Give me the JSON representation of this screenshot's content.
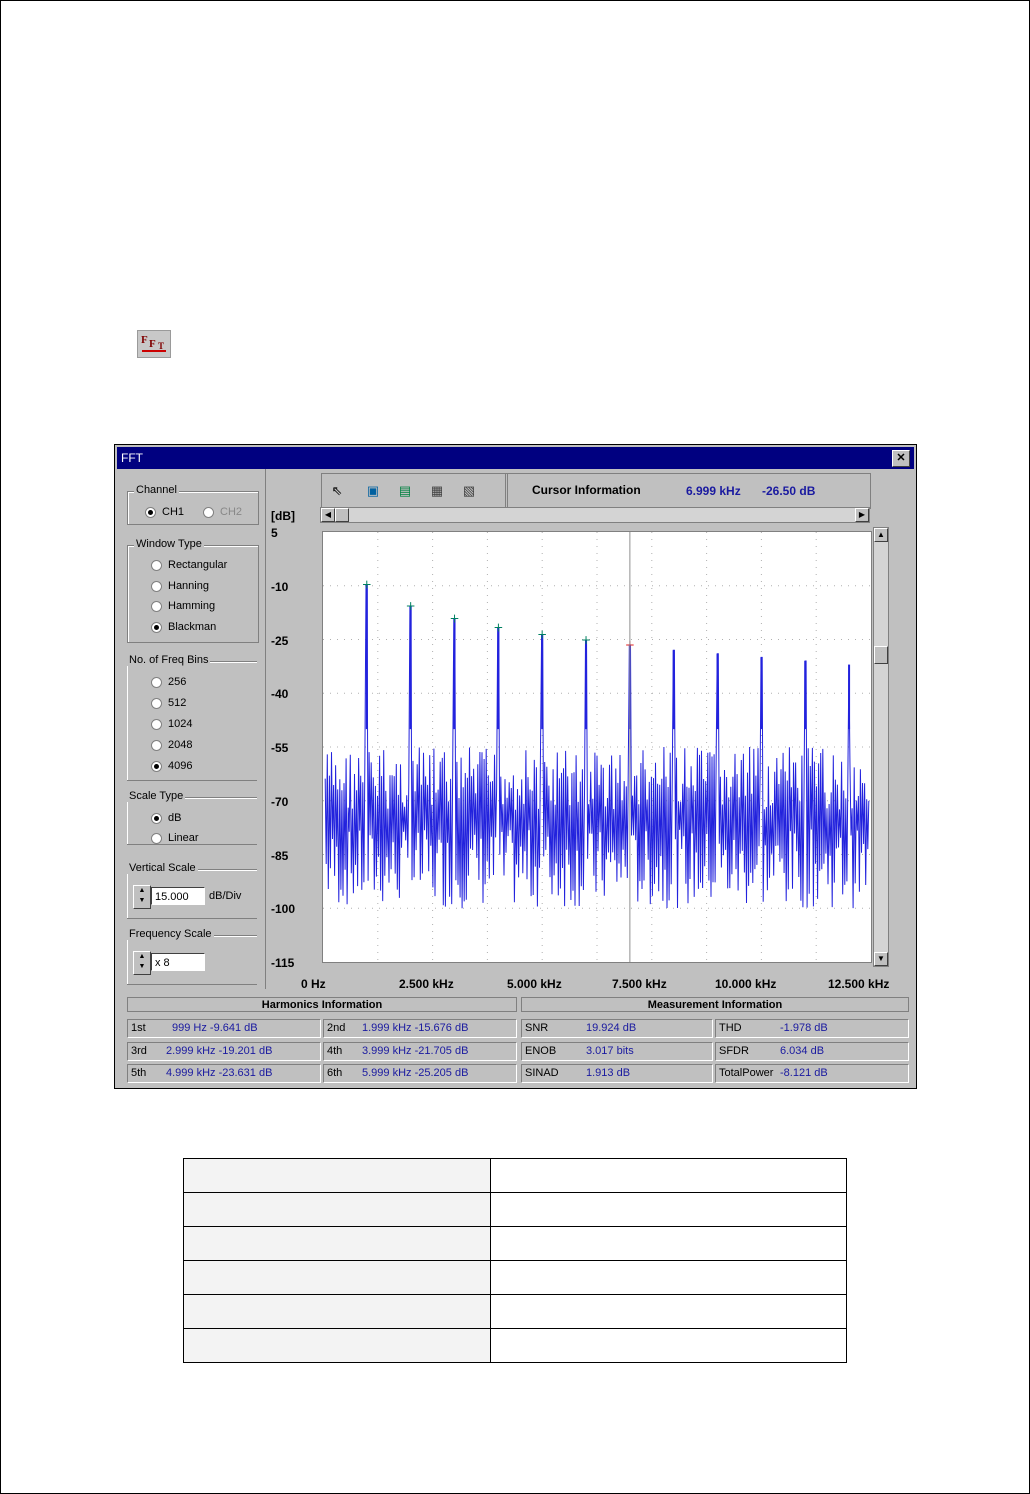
{
  "window": {
    "title": "FFT",
    "close_glyph": "✕"
  },
  "fft_icon": {
    "label": "FFT"
  },
  "channel": {
    "label": "Channel",
    "options": [
      {
        "label": "CH1",
        "selected": true,
        "enabled": true
      },
      {
        "label": "CH2",
        "selected": false,
        "enabled": false
      }
    ]
  },
  "window_type": {
    "label": "Window Type",
    "options": [
      {
        "label": "Rectangular",
        "selected": false
      },
      {
        "label": "Hanning",
        "selected": false
      },
      {
        "label": "Hamming",
        "selected": false
      },
      {
        "label": "Blackman",
        "selected": true
      }
    ]
  },
  "freq_bins": {
    "label": "No. of Freq Bins",
    "options": [
      {
        "label": "256",
        "selected": false
      },
      {
        "label": "512",
        "selected": false
      },
      {
        "label": "1024",
        "selected": false
      },
      {
        "label": "2048",
        "selected": false
      },
      {
        "label": "4096",
        "selected": true
      }
    ]
  },
  "scale_type": {
    "label": "Scale Type",
    "options": [
      {
        "label": "dB",
        "selected": true
      },
      {
        "label": "Linear",
        "selected": false
      }
    ]
  },
  "vertical_scale": {
    "label": "Vertical Scale",
    "value": "15.000",
    "unit": "dB/Div"
  },
  "frequency_scale": {
    "label": "Frequency Scale",
    "value": "x 8"
  },
  "cursor": {
    "label": "Cursor Information",
    "freq": "6.999 kHz",
    "amplitude": "-26.50 dB"
  },
  "chart_data": {
    "type": "line",
    "ylabel": "[dB]",
    "ylim": [
      -115,
      5
    ],
    "xlim": [
      0,
      12.5
    ],
    "yticks": [
      "5",
      "-10",
      "-25",
      "-40",
      "-55",
      "-70",
      "-85",
      "-100",
      "-115"
    ],
    "xticks": [
      "0 Hz",
      "2.500 kHz",
      "5.000 kHz",
      "7.500 kHz",
      "10.000 kHz",
      "12.500 kHz"
    ],
    "series": [
      {
        "x": [
          1.0,
          2.0,
          3.0,
          4.0,
          5.0,
          6.0,
          7.0,
          8.0,
          9.0,
          10.0,
          11.0,
          12.0
        ],
        "values": [
          -9.641,
          -15.676,
          -19.201,
          -21.705,
          -23.631,
          -25.205,
          -26.5,
          -28.0,
          -29.0,
          -30.0,
          -31.0,
          -32.0
        ]
      }
    ],
    "noise_floor": [
      -55,
      -100
    ],
    "cursor_x": 7.0,
    "grid": true,
    "line_color": "#2222dd",
    "marker_color": "#008060",
    "cursor_marker_color": "#e02020"
  },
  "harmonics": {
    "title": "Harmonics Information",
    "rows": [
      {
        "k": "1st",
        "v": "999 Hz  -9.641 dB"
      },
      {
        "k": "2nd",
        "v": "1.999 kHz  -15.676 dB"
      },
      {
        "k": "3rd",
        "v": "2.999 kHz  -19.201 dB"
      },
      {
        "k": "4th",
        "v": "3.999 kHz  -21.705 dB"
      },
      {
        "k": "5th",
        "v": "4.999 kHz  -23.631 dB"
      },
      {
        "k": "6th",
        "v": "5.999 kHz  -25.205 dB"
      }
    ]
  },
  "measurement": {
    "title": "Measurement Information",
    "rows": [
      {
        "k": "SNR",
        "v": "19.924 dB"
      },
      {
        "k": "THD",
        "v": "-1.978 dB"
      },
      {
        "k": "ENOB",
        "v": "3.017 bits"
      },
      {
        "k": "SFDR",
        "v": "6.034 dB"
      },
      {
        "k": "SINAD",
        "v": "1.913 dB"
      },
      {
        "k": "TotalPower",
        "v": "-8.121 dB"
      }
    ]
  }
}
